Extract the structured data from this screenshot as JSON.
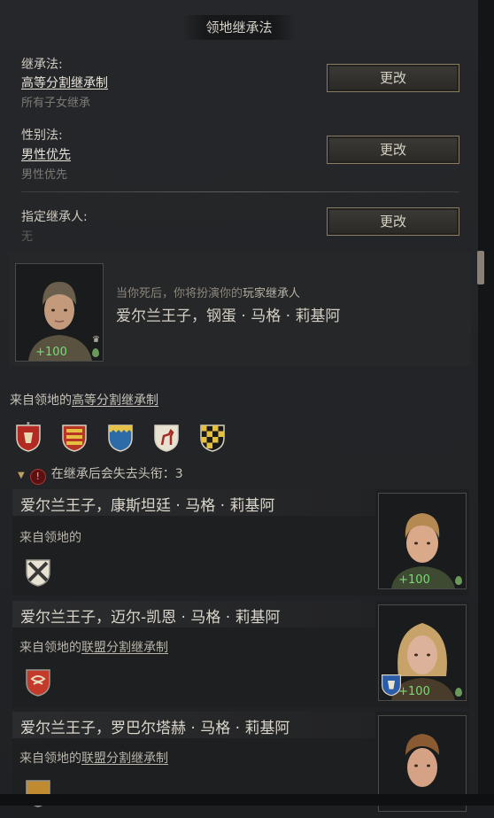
{
  "section_title": "领地继承法",
  "succession": {
    "label": "继承法:",
    "value": "高等分割继承制",
    "desc": "所有子女继承",
    "button": "更改"
  },
  "gender": {
    "label": "性别法:",
    "value": "男性优先",
    "desc": "男性优先",
    "button": "更改"
  },
  "designated": {
    "label": "指定继承人:",
    "value": "无",
    "button": "更改"
  },
  "player_heir": {
    "note_prefix": "当你死后，你将扮演你的",
    "note_highlight": "玩家继承人",
    "name": "爱尔兰王子，钢蛋 · 马格 · 莉基阿",
    "opinion": "+100"
  },
  "from_realm": {
    "prefix": "来自领地的",
    "law": "高等分割继承制"
  },
  "titles_lost": "在继承后会失去头衔：3",
  "heirs": [
    {
      "name": "爱尔兰王子，康斯坦廷 · 马格 · 莉基阿",
      "from_prefix": "来自领地的",
      "law": "",
      "opinion": "+100"
    },
    {
      "name": "爱尔兰王子，迈尔-凯恩 · 马格 · 莉基阿",
      "from_prefix": "来自领地的",
      "law": "联盟分割继承制",
      "opinion": "+100"
    },
    {
      "name": "爱尔兰王子，罗巴尔塔赫 · 马格 · 莉基阿",
      "from_prefix": "来自领地的",
      "law": "联盟分割继承制",
      "opinion": ""
    }
  ],
  "colors": {
    "positive": "#6fe06f",
    "button_border": "#8a7c63",
    "warning": "#b03030"
  }
}
